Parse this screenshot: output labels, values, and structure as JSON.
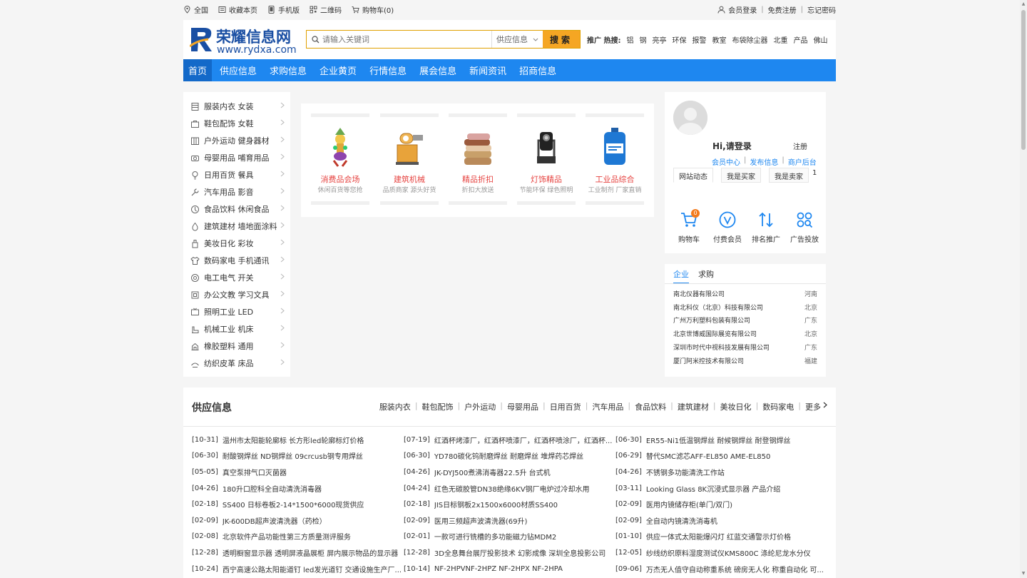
{
  "topbar": {
    "left": [
      {
        "label": "全国",
        "icon": "location-icon"
      },
      {
        "label": "收藏本页",
        "icon": "bookmark-icon"
      },
      {
        "label": "手机版",
        "icon": "mobile-icon"
      },
      {
        "label": "二维码",
        "icon": "qrcode-icon"
      },
      {
        "label": "购物车(0)",
        "icon": "cart-icon"
      }
    ],
    "right": {
      "login": "会员登录",
      "register": "免费注册",
      "forgot": "忘记密码"
    }
  },
  "header": {
    "logo_text": "荣耀信息网",
    "logo_url": "www.rydxa.com",
    "search_placeholder": "请输入关键词",
    "search_category": "供应信息",
    "search_button": "搜索",
    "promo_label": "推广 热搜:",
    "promo_keywords": [
      "铝",
      "钢",
      "亮亭",
      "环保",
      "报警",
      "教室",
      "布袋除尘器",
      "北重",
      "产品",
      "佛山"
    ]
  },
  "nav": [
    "首页",
    "供应信息",
    "求购信息",
    "企业黄页",
    "行情信息",
    "展会信息",
    "新闻资讯",
    "招商信息"
  ],
  "categories": [
    {
      "label": "服装内衣 女装",
      "icon": "clothing-icon"
    },
    {
      "label": "鞋包配饰 女鞋",
      "icon": "bag-icon"
    },
    {
      "label": "户外运动 健身器材",
      "icon": "outdoor-icon"
    },
    {
      "label": "母婴用品 哺育用品",
      "icon": "baby-icon"
    },
    {
      "label": "日用百货 餐具",
      "icon": "bulb-icon"
    },
    {
      "label": "汽车用品 影音",
      "icon": "wrench-icon"
    },
    {
      "label": "食品饮料 休闲食品",
      "icon": "food-icon"
    },
    {
      "label": "建筑建材 墙地面涂料",
      "icon": "drop-icon"
    },
    {
      "label": "美妆日化 彩妆",
      "icon": "cosmetics-icon"
    },
    {
      "label": "数码家电 手机通讯",
      "icon": "shirt-icon"
    },
    {
      "label": "电工电气 开关",
      "icon": "electric-icon"
    },
    {
      "label": "办公文教 学习文具",
      "icon": "office-icon"
    },
    {
      "label": "照明工业 LED",
      "icon": "tv-icon"
    },
    {
      "label": "机械工业 机床",
      "icon": "machine-icon"
    },
    {
      "label": "橡胶塑料 通用",
      "icon": "rubber-icon"
    },
    {
      "label": "纺织皮革 床品",
      "icon": "textile-icon"
    }
  ],
  "products": [
    {
      "title": "消费品会场",
      "sub": "休闲百货等您抢",
      "icon": "toy-image"
    },
    {
      "title": "建筑机械",
      "sub": "品质商家 源头好货",
      "icon": "machine-image"
    },
    {
      "title": "精品折扣",
      "sub": "折扣大放送",
      "icon": "towels-image"
    },
    {
      "title": "灯饰精品",
      "sub": "节能环保 绿色照明",
      "icon": "stage-light-image"
    },
    {
      "title": "工业品综合",
      "sub": "工业制剂 厂家直销",
      "icon": "barrel-image"
    }
  ],
  "user": {
    "greeting": "Hi,请登录",
    "register": "注册",
    "links": [
      "会员中心",
      "发布信息",
      "商户后台"
    ],
    "tabs": [
      "网站动态",
      "我是买家",
      "我是卖家"
    ],
    "tab_number": "1",
    "actions": [
      {
        "label": "购物车",
        "icon": "cart-icon",
        "badge": "0"
      },
      {
        "label": "付费会员",
        "icon": "vip-icon"
      },
      {
        "label": "排名推广",
        "icon": "rank-icon"
      },
      {
        "label": "广告投放",
        "icon": "ad-icon"
      }
    ]
  },
  "companies": {
    "tabs": [
      "企业",
      "求购"
    ],
    "rows": [
      {
        "name": "南北仪器有限公司",
        "region": "河南"
      },
      {
        "name": "南北科仪（北京）科技有限公司",
        "region": "北京"
      },
      {
        "name": "广州万利塑料包装有限公司",
        "region": "广东"
      },
      {
        "name": "北京世博威国际展览有限公司",
        "region": "北京"
      },
      {
        "name": "深圳市时代中视科技发展有限公司",
        "region": "广东"
      },
      {
        "name": "厦门阿米控技术有限公司",
        "region": "福建"
      }
    ]
  },
  "supply": {
    "title": "供应信息",
    "tabs": [
      "服装内衣",
      "鞋包配饰",
      "户外运动",
      "母婴用品",
      "日用百货",
      "汽车用品",
      "食品饮料",
      "建筑建材",
      "美妆日化",
      "数码家电",
      "更多"
    ],
    "items": [
      {
        "date": "[10-31]",
        "text": "温州市太阳能轮廓标 长方形led轮廓标灯价格"
      },
      {
        "date": "[07-19]",
        "text": "红酒杯烤漆厂，红酒杯喷漆厂，红酒杯喷涂厂，红酒杯..."
      },
      {
        "date": "[06-30]",
        "text": "ER55-Ni1低温钢焊丝 耐候钢焊丝 耐登钢焊丝"
      },
      {
        "date": "[06-30]",
        "text": "耐酸钢焊丝 ND钢焊丝 09crcusb钢专用焊丝"
      },
      {
        "date": "[06-30]",
        "text": "YD780碳化钨耐磨焊丝 耐磨焊丝 堆焊药芯焊丝"
      },
      {
        "date": "[06-29]",
        "text": "替代SMC滤芯AFF-EL850 AME-EL850"
      },
      {
        "date": "[05-05]",
        "text": "真空泵排气口灭菌器"
      },
      {
        "date": "[04-26]",
        "text": "JK-DYJ500煮沸消毒器22.5升 台式机"
      },
      {
        "date": "[04-26]",
        "text": "不锈钢多功能清洗工作站"
      },
      {
        "date": "[04-26]",
        "text": "180升口腔科全自动清洗消毒器"
      },
      {
        "date": "[04-24]",
        "text": "红色无碳胶管DN38绝缘6KV钢厂电炉过冷却水用"
      },
      {
        "date": "[03-11]",
        "text": "Looking Glass 8K沉浸式显示器 产品介绍"
      },
      {
        "date": "[02-18]",
        "text": "SS400 日标卷板2-14*1500*6000现货供应"
      },
      {
        "date": "[02-18]",
        "text": "JIS日标钢板2x1500x6000材质SS400"
      },
      {
        "date": "[02-09]",
        "text": "医用内镜储存柜(单门/双门)"
      },
      {
        "date": "[02-09]",
        "text": "JK-600DB超声波清洗器（药检）"
      },
      {
        "date": "[02-09]",
        "text": "医用三频超声波清洗器(69升)"
      },
      {
        "date": "[02-09]",
        "text": "全自动内镜清洗消毒机"
      },
      {
        "date": "[02-08]",
        "text": "北京软件产品功能性第三方质量测评服务"
      },
      {
        "date": "[02-01]",
        "text": "一款可进行铣槽的多功能磁力钻MDM2"
      },
      {
        "date": "[01-10]",
        "text": "供应一体式太阳能爆闪灯 红蓝交通警示灯价格"
      },
      {
        "date": "[12-28]",
        "text": "透明橱窗显示器 透明屏液晶展柜 屏内展示物品的显示器"
      },
      {
        "date": "[12-28]",
        "text": "3D全息舞台展厅投影技术 幻影成像 深圳全息投影公司"
      },
      {
        "date": "[12-05]",
        "text": "纱线纺织原料湿度测试仪KMS800C 涤纶尼龙水分仪"
      },
      {
        "date": "[10-24]",
        "text": "西宁高速公路太阳能道钉 led发光道钉 交通设施生产厂..."
      },
      {
        "date": "[10-14]",
        "text": "NF-2HPVNF-2HPZ NF-2HPX NF-2HPA"
      },
      {
        "date": "[09-06]",
        "text": "万杰无人值守自动称重系统 磅房无人化 称重自动化 可..."
      }
    ]
  }
}
